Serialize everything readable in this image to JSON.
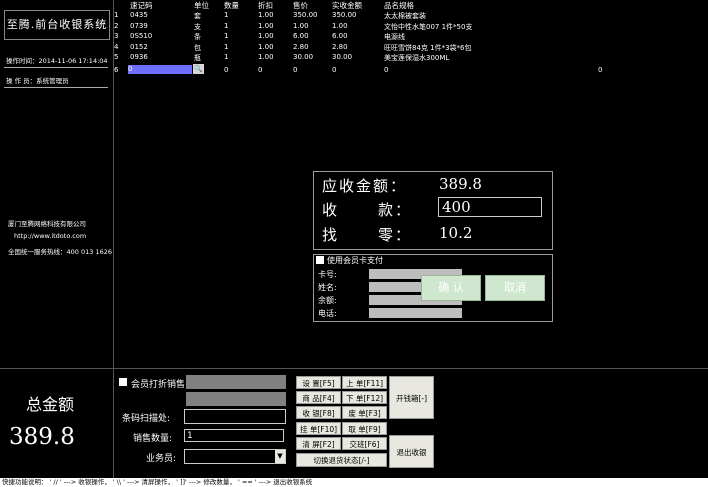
{
  "sidebar": {
    "title": "至腾.前台收银系统",
    "op_time_label": "操作时间：",
    "op_time_value": "2014-11-06 17:14:04",
    "operator_label": "操 作 员：",
    "operator_value": "系统管理员",
    "company": "厦门至腾网络科技有限公司",
    "website": "http://www.itdoto.com",
    "hotline": "全国统一服务热线：400 013 1626"
  },
  "grid": {
    "headers": [
      "速记码",
      "单位",
      "数量",
      "折扣",
      "售价",
      "实收金额",
      "品名规格"
    ],
    "rows": [
      {
        "idx": "1",
        "code": "0435",
        "unit": "套",
        "qty": "1",
        "disc": "1.00",
        "price": "350.00",
        "amount": "350.00",
        "name": "太太棉被套装"
      },
      {
        "idx": "2",
        "code": "0739",
        "unit": "支",
        "qty": "1",
        "disc": "1.00",
        "price": "1.00",
        "amount": "1.00",
        "name": "文怡中性水笔007 1件*50支"
      },
      {
        "idx": "3",
        "code": "0S510",
        "unit": "条",
        "qty": "1",
        "disc": "1.00",
        "price": "6.00",
        "amount": "6.00",
        "name": "电源线"
      },
      {
        "idx": "4",
        "code": "0152",
        "unit": "包",
        "qty": "1",
        "disc": "1.00",
        "price": "2.80",
        "amount": "2.80",
        "name": "旺旺雪饼84克 1件*3袋*6包"
      },
      {
        "idx": "5",
        "code": "0936",
        "unit": "瓶",
        "qty": "1",
        "disc": "1.00",
        "price": "30.00",
        "amount": "30.00",
        "name": "美宝莲保湿水300ML"
      }
    ],
    "edit_row": {
      "idx": "6",
      "code": "0",
      "unit": "",
      "qty": "0",
      "disc": "0",
      "price": "0",
      "amount": "0",
      "name": "0",
      "extra": "0"
    }
  },
  "payment": {
    "due_label": "应收金额：",
    "due_value": "389.8",
    "received_label_1": "收",
    "received_label_2": "款：",
    "received_value": "400",
    "change_label_1": "找",
    "change_label_2": "零：",
    "change_value": "10.2"
  },
  "member_pay": {
    "checkbox_label": "使用会员卡支付",
    "card_label": "卡号:",
    "name_label": "姓名:",
    "balance_label": "余额:",
    "phone_label": "电话:",
    "confirm": "确 认",
    "cancel": "取消"
  },
  "total": {
    "label": "总金额",
    "value": "389.8"
  },
  "form": {
    "member_discount": "会员打折销售",
    "barcode_label": "条码扫描处:",
    "qty_label": "销售数量:",
    "qty_value": "1",
    "clerk_label": "业务员:"
  },
  "buttons": {
    "settings": "设 置[F5]",
    "prev": "上 单[F11]",
    "open_box": "开钱箱[-]",
    "goods": "商 品[F4]",
    "next": "下 单[F12]",
    "receive": "收 银[F8]",
    "void": "废 单[F3]",
    "hang": "挂 单[F10]",
    "take": "取 单[F9]",
    "clear": "清 屏[F2]",
    "shift": "交班[F6]",
    "exit": "退出收银",
    "toggle_return": "切换退货状态[/-]"
  },
  "statusbar": {
    "text": "快捷功能说明： ' // ' ---> 收银操作， ' \\\\ ' ---> 清屏操作， ' ]]' ---> 修改数量， ' == ' ---> 退出收银系统"
  }
}
